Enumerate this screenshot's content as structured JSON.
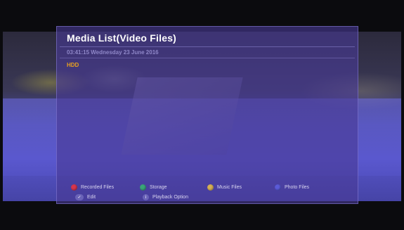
{
  "panel": {
    "title": "Media List(Video Files)",
    "datetime": "03:41:15 Wednesday 23 June 2016",
    "items": [
      {
        "label": "HDD"
      }
    ]
  },
  "footer": {
    "keys": [
      {
        "label": "Recorded Files",
        "color": "#d8354e"
      },
      {
        "label": "Storage",
        "color": "#3aa57a"
      },
      {
        "label": "Music Files",
        "color": "#d6b056"
      },
      {
        "label": "Photo Files",
        "color": "#5b5bd8"
      }
    ],
    "edit": {
      "label": "Edit",
      "icon": "checkmark-icon"
    },
    "playback": {
      "label": "Playback Option",
      "icon": "info-icon"
    }
  },
  "colors": {
    "panel_bg": "#483a96",
    "accent_orange": "#e8a020",
    "date_text": "#8f87c8"
  }
}
